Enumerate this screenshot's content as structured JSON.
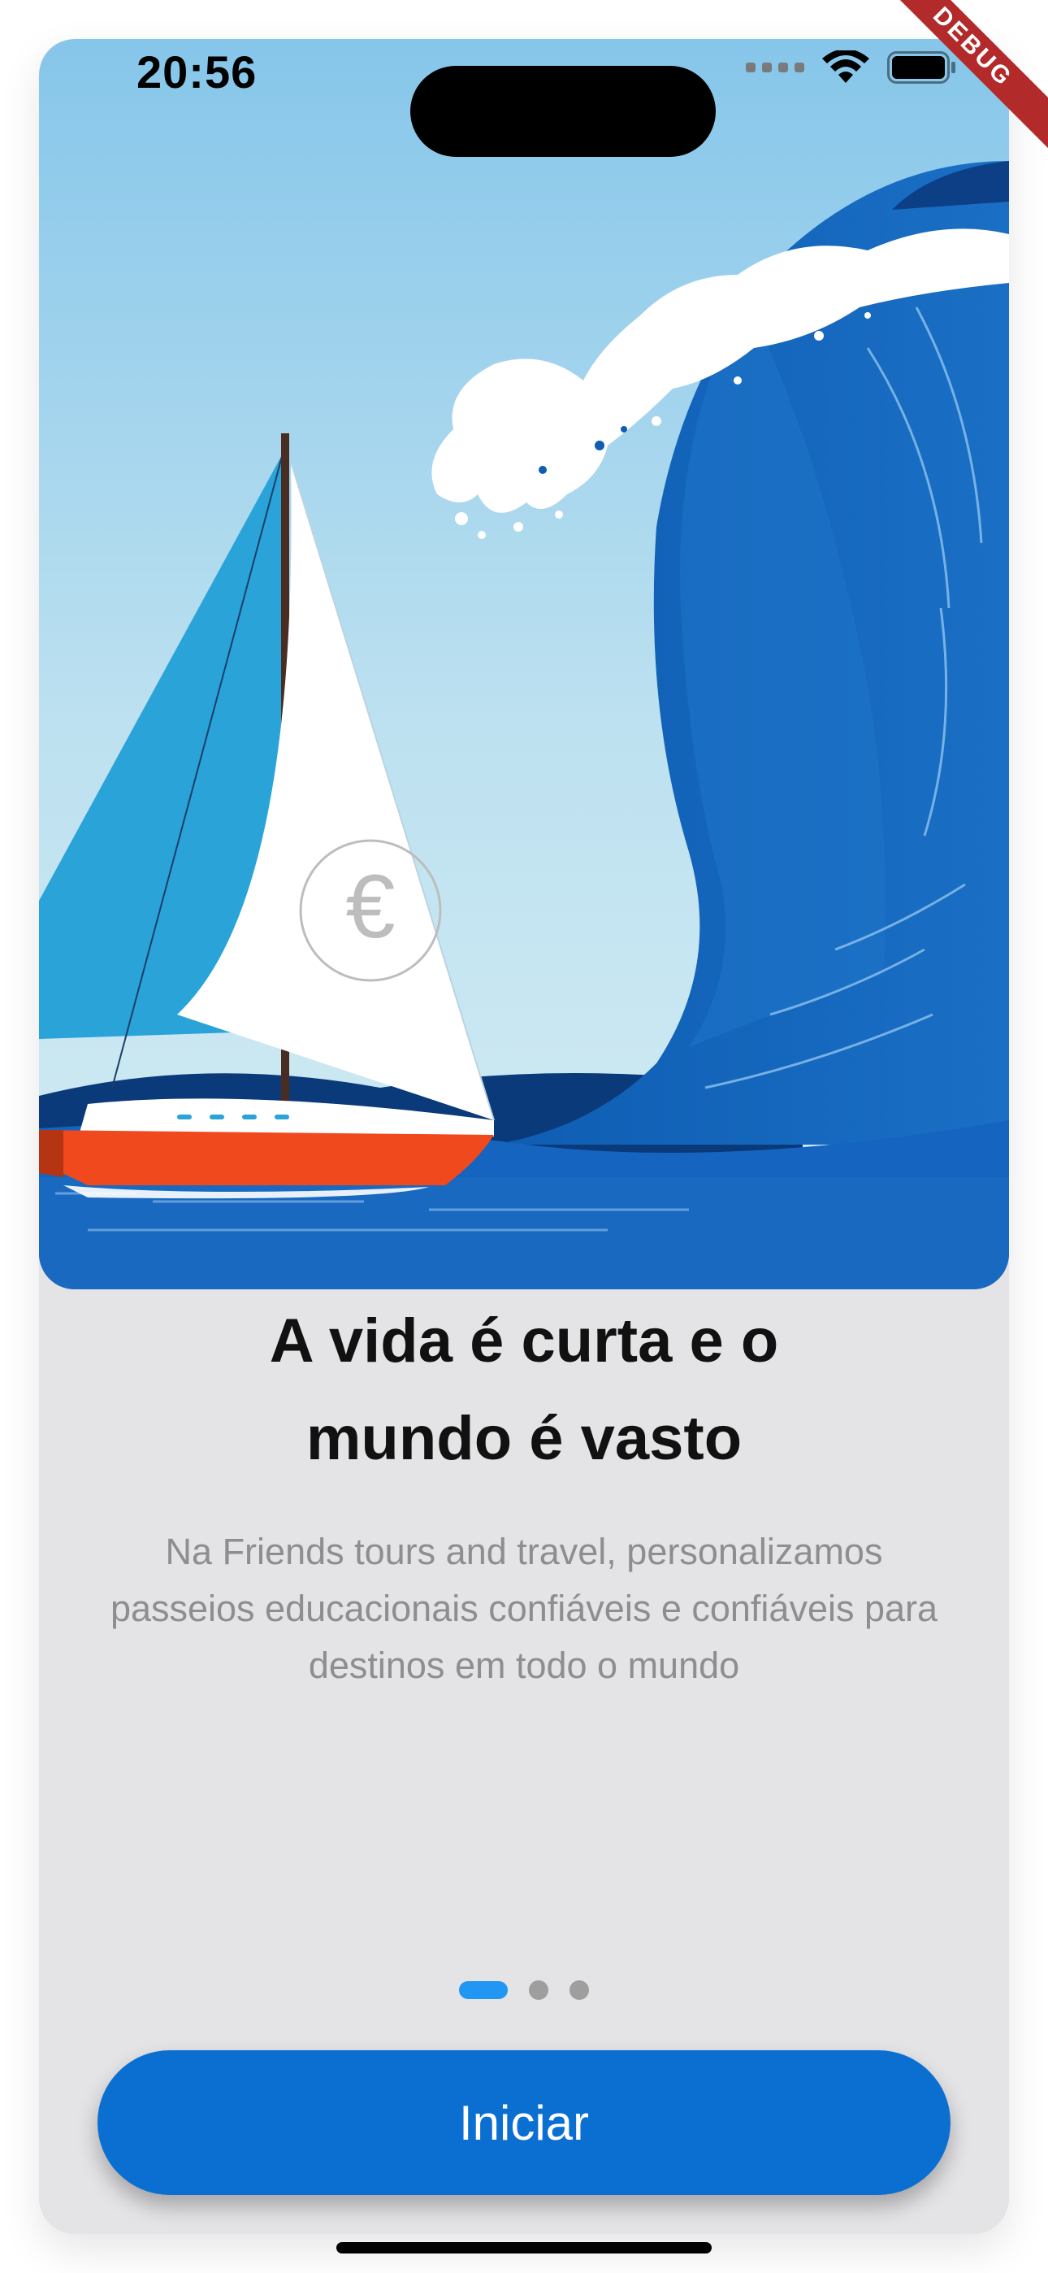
{
  "status_bar": {
    "time": "20:56"
  },
  "debug_banner": "DEBUG",
  "onboarding": {
    "illustration": "sailboat-wave-illustration",
    "title": "A vida é curta e o mundo é vasto",
    "description": "Na Friends tours and travel, personalizamos passeios educacionais confiáveis e confiáveis para destinos em todo o mundo",
    "page_indicator": {
      "total": 3,
      "current": 1
    },
    "start_button_label": "Iniciar"
  },
  "colors": {
    "accent": "#0b6fd1",
    "indicator_active": "#2196f3",
    "background": "#e4e4e6"
  }
}
